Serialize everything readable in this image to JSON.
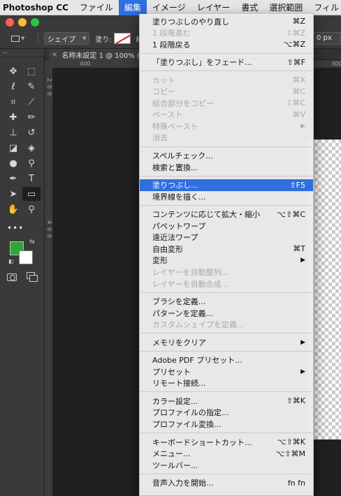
{
  "menubar": {
    "apple_icon": "apple-logo-icon",
    "items": [
      {
        "label": "Photoshop CC",
        "app": true
      },
      {
        "label": "ファイル"
      },
      {
        "label": "編集",
        "active": true
      },
      {
        "label": "イメージ"
      },
      {
        "label": "レイヤー"
      },
      {
        "label": "書式"
      },
      {
        "label": "選択範囲"
      },
      {
        "label": "フィル"
      }
    ]
  },
  "options_bar": {
    "mode": "シェイプ",
    "fill_label": "塗り:",
    "stroke_label": "線:",
    "width_value": "0 px"
  },
  "document": {
    "tab_title": "名称未設定 1 @ 100% (L",
    "ruler_top": [
      "400",
      "300"
    ],
    "ruler_left": [
      "2",
      "0",
      "0",
      "4",
      "0",
      "0"
    ]
  },
  "tools": [
    {
      "icon": "move-icon",
      "glyph": "✥"
    },
    {
      "icon": "marquee-icon",
      "glyph": "⬚"
    },
    {
      "icon": "lasso-icon",
      "glyph": "ℓ"
    },
    {
      "icon": "quick-select-icon",
      "glyph": "✎"
    },
    {
      "icon": "crop-icon",
      "glyph": "⌗"
    },
    {
      "icon": "eyedropper-icon",
      "glyph": "⟋"
    },
    {
      "icon": "healing-icon",
      "glyph": "✚"
    },
    {
      "icon": "brush-icon",
      "glyph": "✏"
    },
    {
      "icon": "stamp-icon",
      "glyph": "⊥"
    },
    {
      "icon": "history-brush-icon",
      "glyph": "↺"
    },
    {
      "icon": "eraser-icon",
      "glyph": "◪"
    },
    {
      "icon": "bucket-icon",
      "glyph": "◈"
    },
    {
      "icon": "blur-icon",
      "glyph": "●"
    },
    {
      "icon": "dodge-icon",
      "glyph": "⚲"
    },
    {
      "icon": "pen-icon",
      "glyph": "✒"
    },
    {
      "icon": "type-icon",
      "glyph": "T"
    },
    {
      "icon": "path-select-icon",
      "glyph": "➤"
    },
    {
      "icon": "rectangle-icon",
      "glyph": "▭",
      "selected": true
    },
    {
      "icon": "hand-icon",
      "glyph": "✋"
    },
    {
      "icon": "zoom-icon",
      "glyph": "⚲"
    }
  ],
  "colors": {
    "foreground": "#2fa63a",
    "background": "#ffffff",
    "highlight": "#2f6fe0"
  },
  "edit_menu": [
    {
      "label": "塗りつぶしのやり直し",
      "shortcut": "⌘Z"
    },
    {
      "label": "1 段階進む",
      "shortcut": "⇧⌘Z",
      "disabled": true
    },
    {
      "label": "1 段階戻る",
      "shortcut": "⌥⌘Z"
    },
    {
      "separator": true
    },
    {
      "label": "「塗りつぶし」をフェード...",
      "shortcut": "⇧⌘F"
    },
    {
      "separator": true
    },
    {
      "label": "カット",
      "shortcut": "⌘X",
      "disabled": true
    },
    {
      "label": "コピー",
      "shortcut": "⌘C",
      "disabled": true
    },
    {
      "label": "結合部分をコピー",
      "shortcut": "⇧⌘C",
      "disabled": true
    },
    {
      "label": "ペースト",
      "shortcut": "⌘V",
      "disabled": true
    },
    {
      "label": "特殊ペースト",
      "submenu": true,
      "disabled": true
    },
    {
      "label": "消去",
      "disabled": true
    },
    {
      "separator": true
    },
    {
      "label": "スペルチェック..."
    },
    {
      "label": "検索と置換..."
    },
    {
      "separator": true
    },
    {
      "label": "塗りつぶし...",
      "shortcut": "⇧F5",
      "highlighted": true
    },
    {
      "label": "境界線を描く..."
    },
    {
      "separator": true
    },
    {
      "label": "コンテンツに応じて拡大・縮小",
      "shortcut": "⌥⇧⌘C"
    },
    {
      "label": "パペットワープ"
    },
    {
      "label": "遠近法ワープ"
    },
    {
      "label": "自由変形",
      "shortcut": "⌘T"
    },
    {
      "label": "変形",
      "submenu": true
    },
    {
      "label": "レイヤーを自動整列...",
      "disabled": true
    },
    {
      "label": "レイヤーを自動合成...",
      "disabled": true
    },
    {
      "separator": true
    },
    {
      "label": "ブラシを定義..."
    },
    {
      "label": "パターンを定義..."
    },
    {
      "label": "カスタムシェイプを定義...",
      "disabled": true
    },
    {
      "separator": true
    },
    {
      "label": "メモリをクリア",
      "submenu": true
    },
    {
      "separator": true
    },
    {
      "label": "Adobe PDF プリセット..."
    },
    {
      "label": "プリセット",
      "submenu": true
    },
    {
      "label": "リモート接続..."
    },
    {
      "separator": true
    },
    {
      "label": "カラー設定...",
      "shortcut": "⇧⌘K"
    },
    {
      "label": "プロファイルの指定..."
    },
    {
      "label": "プロファイル変換..."
    },
    {
      "separator": true
    },
    {
      "label": "キーボードショートカット...",
      "shortcut": "⌥⇧⌘K"
    },
    {
      "label": "メニュー...",
      "shortcut": "⌥⇧⌘M"
    },
    {
      "label": "ツールバー..."
    },
    {
      "separator": true
    },
    {
      "label": "音声入力を開始...",
      "shortcut": "fn fn"
    }
  ]
}
